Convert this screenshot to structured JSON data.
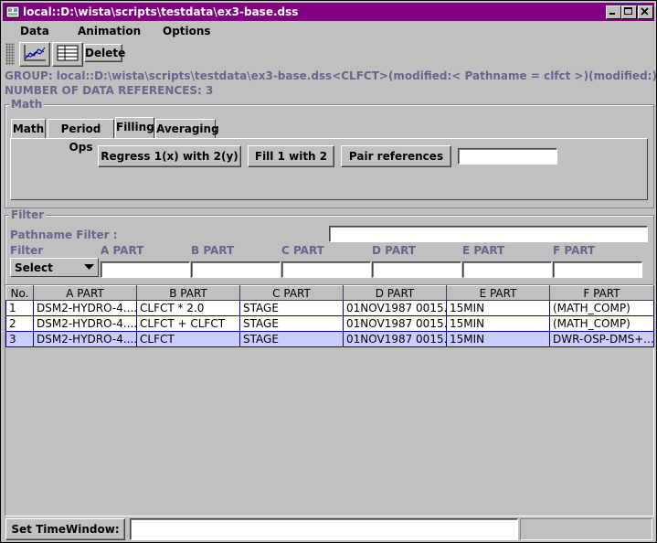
{
  "window": {
    "title": "local::D:\\wista\\scripts\\testdata\\ex3-base.dss"
  },
  "menubar": {
    "items": [
      "Data",
      "Animation",
      "Options"
    ]
  },
  "toolbar": {
    "delete_label": "Delete"
  },
  "info": {
    "group_line": "GROUP: local::D:\\wista\\scripts\\testdata\\ex3-base.dss<CLFCT>(modified:< Pathname = clfct >)(modified:)",
    "refs_line": "NUMBER OF DATA REFERENCES: 3"
  },
  "math": {
    "legend": "Math",
    "tabs": [
      "Math",
      "Period Ops",
      "Filling",
      "Averaging"
    ],
    "active_tab": "Filling",
    "buttons": [
      "Regress 1(x) with 2(y)",
      "Fill 1 with 2",
      "Pair references"
    ],
    "text_value": ""
  },
  "filter": {
    "legend": "Filter",
    "pathname_label": "Pathname Filter :",
    "pathname_value": "",
    "filter_label": "Filter",
    "select_value": "Select",
    "part_labels": [
      "A PART",
      "B PART",
      "C PART",
      "D PART",
      "E PART",
      "F PART"
    ],
    "part_values": [
      "",
      "",
      "",
      "",
      "",
      ""
    ]
  },
  "table": {
    "columns": [
      "No.",
      "A PART",
      "B PART",
      "C PART",
      "D PART",
      "E PART",
      "F PART"
    ],
    "rows": [
      [
        "1",
        "DSM2-HYDRO-4....",
        "CLFCT * 2.0",
        "STAGE",
        "01NOV1987 0015...",
        "15MIN",
        "(MATH_COMP)"
      ],
      [
        "2",
        "DSM2-HYDRO-4....",
        "CLFCT + CLFCT",
        "STAGE",
        "01NOV1987 0015...",
        "15MIN",
        "(MATH_COMP)"
      ],
      [
        "3",
        "DSM2-HYDRO-4....",
        "CLFCT",
        "STAGE",
        "01NOV1987 0015...",
        "15MIN",
        "DWR-OSP-DMS+..."
      ]
    ],
    "selected_row": 3
  },
  "statusbar": {
    "timewindow_label": "Set TimeWindow:",
    "timewindow_value": ""
  },
  "colors": {
    "title_bg": "#800080",
    "label_text": "#66668a",
    "selection": "#ccccff",
    "grid_line": "#000099"
  }
}
